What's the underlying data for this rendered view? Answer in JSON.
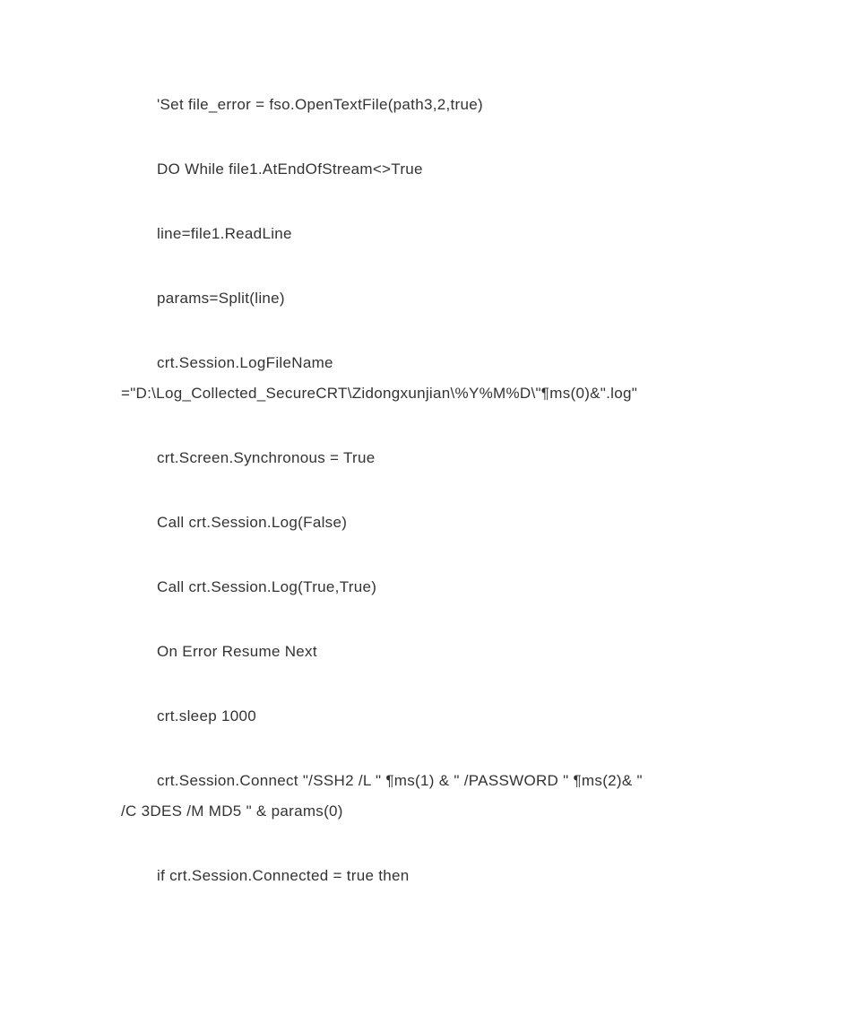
{
  "lines": [
    {
      "cls": "indent",
      "text": "'Set file_error = fso.OpenTextFile(path3,2,true)"
    },
    {
      "cls": "indent",
      "text": "DO While file1.AtEndOfStream<>True"
    },
    {
      "cls": "indent",
      "text": "line=file1.ReadLine"
    },
    {
      "cls": "indent",
      "text": "params=Split(line)"
    },
    {
      "cls": "group",
      "rows": [
        {
          "cls": "indent",
          "text": "crt.Session.LogFileName "
        },
        {
          "cls": "noindent",
          "text": "=\"D:\\Log_Collected_SecureCRT\\Zidongxunjian\\%Y%M%D\\\"¶ms(0)&\".log\""
        }
      ]
    },
    {
      "cls": "indent",
      "text": "crt.Screen.Synchronous = True"
    },
    {
      "cls": "indent",
      "text": "Call crt.Session.Log(False)"
    },
    {
      "cls": "indent",
      "text": "Call crt.Session.Log(True,True)"
    },
    {
      "cls": "indent",
      "text": "On Error Resume Next"
    },
    {
      "cls": "indent",
      "text": "crt.sleep 1000"
    },
    {
      "cls": "group",
      "rows": [
        {
          "cls": "indent",
          "text": "crt.Session.Connect \"/SSH2 /L \" ¶ms(1) & \" /PASSWORD \" ¶ms(2)& \" "
        },
        {
          "cls": "noindent",
          "text": "/C 3DES /M MD5 \" & params(0)"
        }
      ]
    },
    {
      "cls": "indent",
      "text": "if crt.Session.Connected = true then"
    }
  ]
}
